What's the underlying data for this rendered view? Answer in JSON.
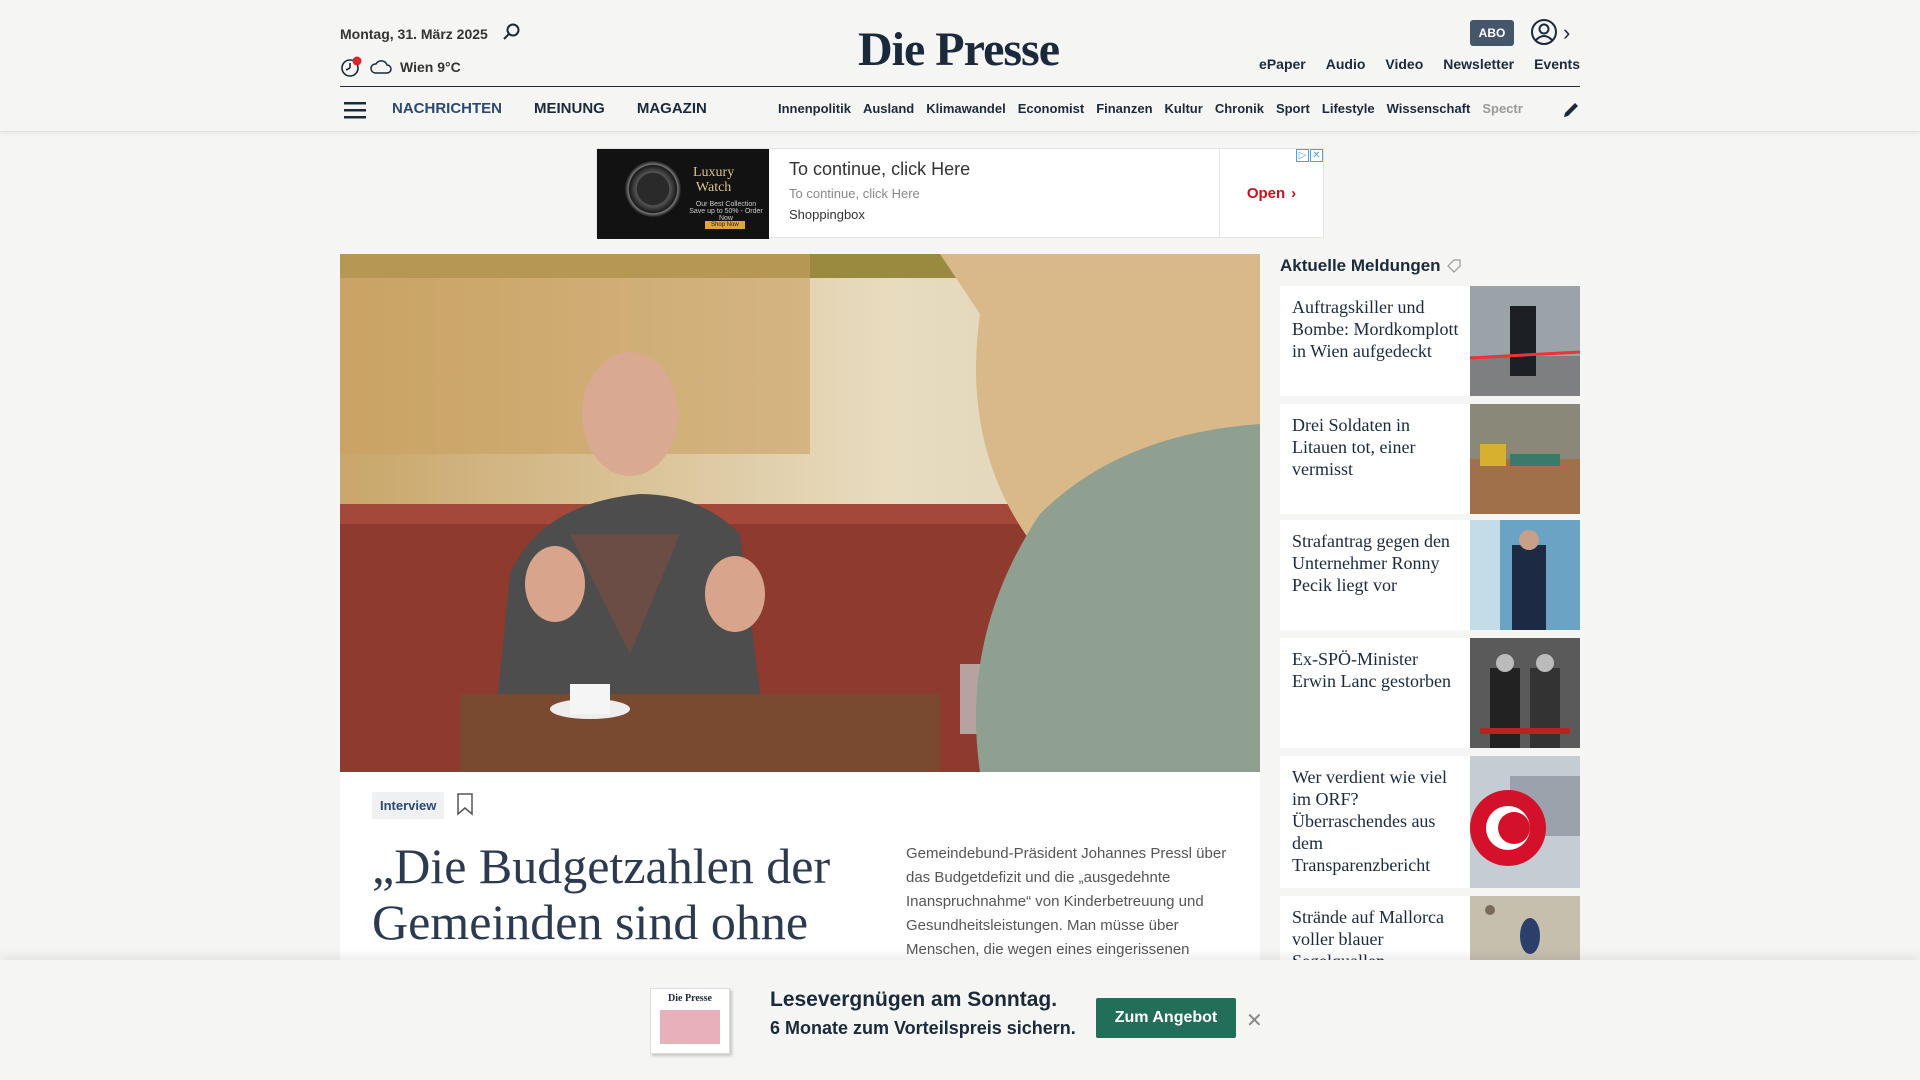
{
  "header": {
    "date": "Montag, 31. März 2025",
    "weather": "Wien 9°C",
    "logo": "Die Presse",
    "abo_label": "ABO",
    "top_links": [
      "ePaper",
      "Audio",
      "Video",
      "Newsletter",
      "Events"
    ],
    "sections": [
      "NACHRICHTEN",
      "MEINUNG",
      "MAGAZIN"
    ],
    "subnav": [
      "Innenpolitik",
      "Ausland",
      "Klimawandel",
      "Economist",
      "Finanzen",
      "Kultur",
      "Chronik",
      "Sport",
      "Lifestyle",
      "Wissenschaft",
      "Spectr"
    ]
  },
  "ad": {
    "headline": "To continue, click Here",
    "sub": "To continue, click Here",
    "brand": "Shoppingbox",
    "open_label": "Open",
    "image_title_1": "Luxury",
    "image_title_2": "Watch",
    "image_sub": "Our Best Collection",
    "image_sub_2": "Save up to 50% - Order Now",
    "image_button": "Shop Now"
  },
  "article": {
    "tag": "Interview",
    "headline": "„Die Budgetzahlen der Gemeinden sind ohne",
    "lede": "Gemeindebund-Präsident Johannes Pressl über das Budgetdefizit und die „ausgedehnte Inanspruchnahme“ von Kinderbetreuung und Gesundheitsleistungen. Man müsse über Menschen, die wegen eines eingerissenen"
  },
  "sidebar": {
    "title": "Aktuelle Meldungen",
    "items": [
      {
        "title": "Auftragskiller und Bombe: Mordkomplott in Wien aufgedeckt"
      },
      {
        "title": "Drei Soldaten in Litauen tot, einer vermisst"
      },
      {
        "title": "Strafantrag gegen den Unternehmer Ronny Pecik liegt vor"
      },
      {
        "title": "Ex-SPÖ-Minister Erwin Lanc gestorben"
      },
      {
        "title": "Wer verdient wie viel im ORF? Überraschendes aus dem Transparenzbericht"
      },
      {
        "title": "Strände auf Mallorca voller blauer Segelquallen"
      }
    ]
  },
  "banner": {
    "headline": "Lesevergnügen am Sonntag.",
    "sub": "6 Monate zum Vorteilspreis sichern.",
    "button": "Zum Angebot",
    "mag_title": "Die Presse"
  }
}
